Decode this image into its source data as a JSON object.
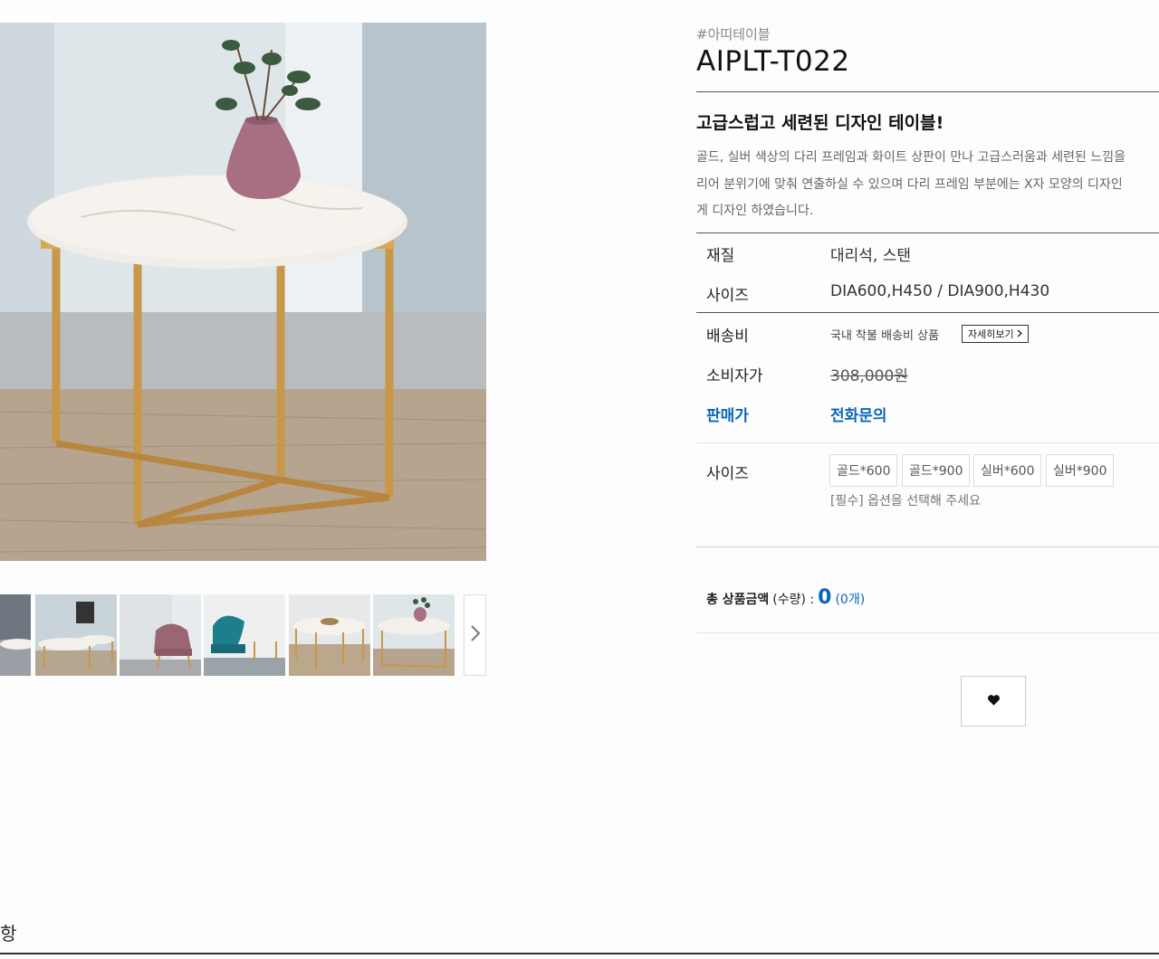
{
  "product": {
    "hashtag": "#아띠테이블",
    "code": "AIPLT-T022",
    "headline": "고급스럽고 세련된 디자인 테이블!",
    "description_lines": [
      "골드, 실버 색상의 다리 프레임과 화이트 상판이 만나 고급스러움과 세련된 느낌을",
      "리어 분위기에 맞춰 연출하실 수 있으며 다리 프레임 부분에는 X자 모양의 디자인",
      "게 디자인 하였습니다."
    ]
  },
  "specs": {
    "material_label": "재질",
    "material_value": "대리석, 스탠",
    "size_label": "사이즈",
    "size_value": "DIA600,H450 / DIA900,H430",
    "shipping_label": "배송비",
    "shipping_value": "국내 착불 배송비 상품",
    "shipping_detail_button": "자세히보기",
    "consumer_price_label": "소비자가",
    "consumer_price_value": "308,000원",
    "sale_price_label": "판매가",
    "sale_price_value": "전화문의"
  },
  "options": {
    "label": "사이즈",
    "choices": [
      "골드*600",
      "골드*900",
      "실버*600",
      "실버*900"
    ],
    "hint": "[필수] 옵션을 선택해 주세요"
  },
  "total": {
    "label": "총 상품금액",
    "qty_label": "(수량) :",
    "amount": "0",
    "qty": "(0개)"
  },
  "bottom_tab": "항",
  "colors": {
    "accent_blue": "#0a66b8",
    "gold": "#c9974a",
    "marble": "#f1ede8"
  },
  "icons": {
    "next": "chevron-right-icon",
    "wishlist": "heart-icon",
    "detail": "chevron-right-icon"
  }
}
